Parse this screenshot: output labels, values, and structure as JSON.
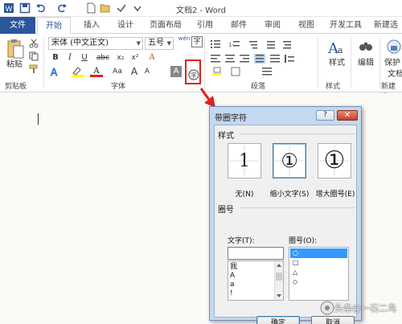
{
  "window": {
    "title": "文档2 - Word"
  },
  "tabs": [
    "文件",
    "开始",
    "插入",
    "设计",
    "页面布局",
    "引用",
    "邮件",
    "审阅",
    "视图",
    "开发工具",
    "新建选"
  ],
  "ribbon": {
    "clipboard": {
      "paste_label": "粘贴",
      "group_label": "剪贴板"
    },
    "font": {
      "font_name": "宋体 (中文正文)",
      "font_size": "五号",
      "wen": "wén",
      "group_label": "字体",
      "buttons": [
        "B",
        "I",
        "U",
        "abc",
        "x₂",
        "x²",
        "A",
        "Aa",
        "A",
        "A",
        "A",
        "字"
      ]
    },
    "paragraph": {
      "group_label": "段落"
    },
    "styles": {
      "label": "样式",
      "group_label": "样式"
    },
    "edit": {
      "label": "编辑"
    },
    "new": {
      "label1": "保护",
      "label2": "文档",
      "group_label": "新建选"
    }
  },
  "dialog": {
    "title": "带圈字符",
    "help": "?",
    "close": "✕",
    "style_section": "样式",
    "style_options": [
      {
        "glyph": "1",
        "label": "无(N)"
      },
      {
        "glyph": "①",
        "label": "缩小文字(S)"
      },
      {
        "glyph": "①",
        "label": "增大圈号(E)"
      }
    ],
    "circle_section": "圈号",
    "text_label": "文字(T):",
    "circle_label": "圈号(O):",
    "text_value": "",
    "text_list": [
      "我",
      "A",
      "a",
      "!"
    ],
    "circle_list": [
      "○",
      "□",
      "△",
      "◇"
    ],
    "ok": "确定",
    "cancel": "取消"
  },
  "watermark": "头条@一石二鸟"
}
